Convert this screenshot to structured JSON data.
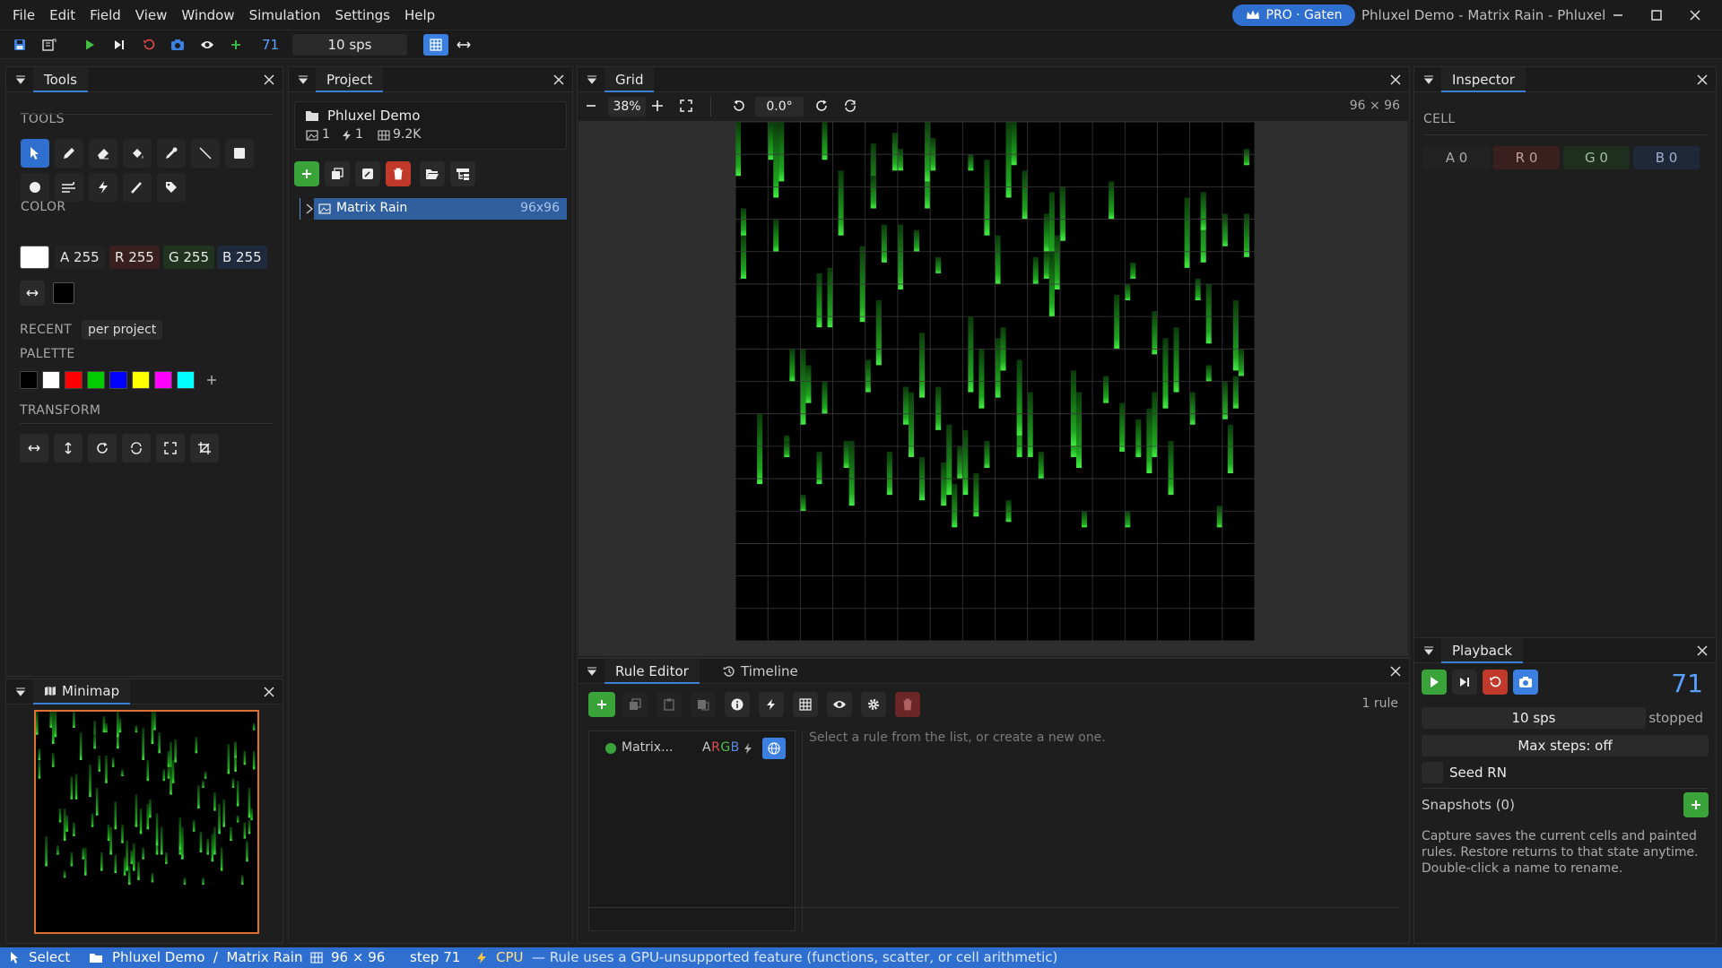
{
  "app": {
    "window_title": "Phluxel Demo - Matrix Rain - Phluxel",
    "pro_badge": "PRO · Gaten",
    "menu": [
      "File",
      "Edit",
      "Field",
      "View",
      "Window",
      "Simulation",
      "Settings",
      "Help"
    ]
  },
  "toolbar": {
    "step": "71",
    "sps": "10 sps"
  },
  "tools_panel": {
    "title": "Tools",
    "tools_label": "TOOLS",
    "color_label": "COLOR",
    "argb": {
      "a": "A 255",
      "r": "R 255",
      "g": "G 255",
      "b": "B 255"
    },
    "primary_color": "#ffffff",
    "secondary_color": "#000000",
    "recent_label": "RECENT",
    "recent_scope": "per project",
    "palette_label": "PALETTE",
    "palette": [
      "#000000",
      "#ffffff",
      "#ff0000",
      "#00cc00",
      "#0000ff",
      "#ffff00",
      "#ff00ff",
      "#00ffff"
    ],
    "transform_label": "TRANSFORM"
  },
  "minimap": {
    "title": "Minimap"
  },
  "project": {
    "title": "Project",
    "name": "Phluxel Demo",
    "image_count": "1",
    "rule_count": "1",
    "cells": "9.2K",
    "tree": [
      {
        "label": "Matrix Rain",
        "size": "96x96"
      }
    ]
  },
  "grid": {
    "title": "Grid",
    "zoom": "38%",
    "rotation": "0.0°",
    "dimensions": "96 × 96"
  },
  "inspector": {
    "title": "Inspector",
    "cell_label": "CELL",
    "values": {
      "a": "A 0",
      "r": "R 0",
      "g": "G 0",
      "b": "B 0"
    }
  },
  "playback": {
    "title": "Playback",
    "step": "71",
    "sps": "10 sps",
    "state": "stopped",
    "max_steps": "Max steps: off",
    "seed": "Seed RN",
    "snapshots": "Snapshots (0)",
    "help": "Capture saves the current cells and painted rules. Restore returns to that state anytime. Double-click a name to rename."
  },
  "rule_editor": {
    "tab_rules": "Rule Editor",
    "tab_timeline": "Timeline",
    "count": "1 rule",
    "rule_name": "Matrix...",
    "rule_channels": "ARGB",
    "placeholder": "Select a rule from the list, or create a new one."
  },
  "status": {
    "tool": "Select",
    "breadcrumb": "Phluxel Demo  /  Matrix Rain",
    "dims": "96 × 96",
    "step": "step 71",
    "backend": "CPU",
    "message": "— Rule uses a GPU-unsupported feature (functions, scatter, or cell arithmetic)"
  },
  "colors": {
    "accent": "#2f6fcf",
    "rain": "#22cc22",
    "danger": "#c0392b",
    "success": "#3aa33a"
  }
}
